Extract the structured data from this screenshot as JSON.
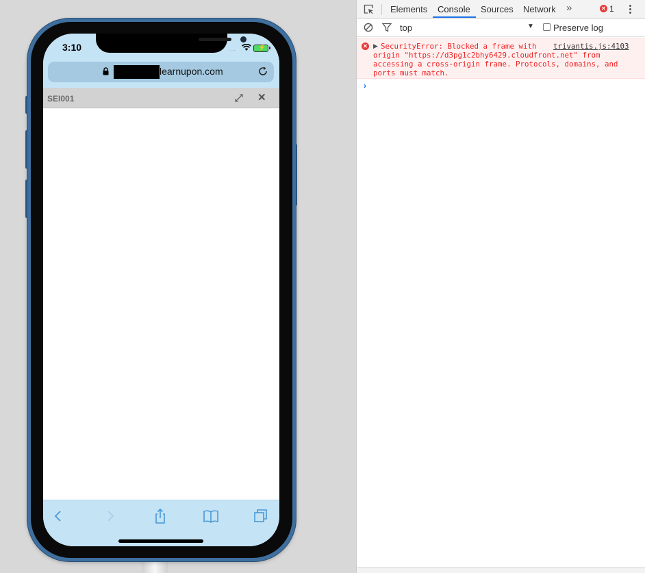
{
  "simulator": {
    "status_time": "3:10",
    "signal_dots": "....",
    "url_domain": "learnupon.com",
    "lightbox_title": "SEI001",
    "close_glyph": "✕",
    "battery_bolt": "⚡"
  },
  "devtools": {
    "tabs": [
      "Elements",
      "Console",
      "Sources",
      "Network"
    ],
    "active_tab": "Console",
    "more_tabs_glyph": "»",
    "error_count": "1",
    "context": "top",
    "context_arrow": "▼",
    "preserve_log": "Preserve log",
    "console": {
      "error_glyph": "✕",
      "expand_glyph": "▶",
      "error_lines": [
        "SecurityError: Blocked a frame with",
        "origin \"https://d3pg1c2bhy6429.cloudfront.net\" from",
        "accessing a cross-origin frame. Protocols, domains, and",
        "ports must match."
      ],
      "error_source": "trivantis.js:4103",
      "prompt_glyph": "›"
    }
  }
}
